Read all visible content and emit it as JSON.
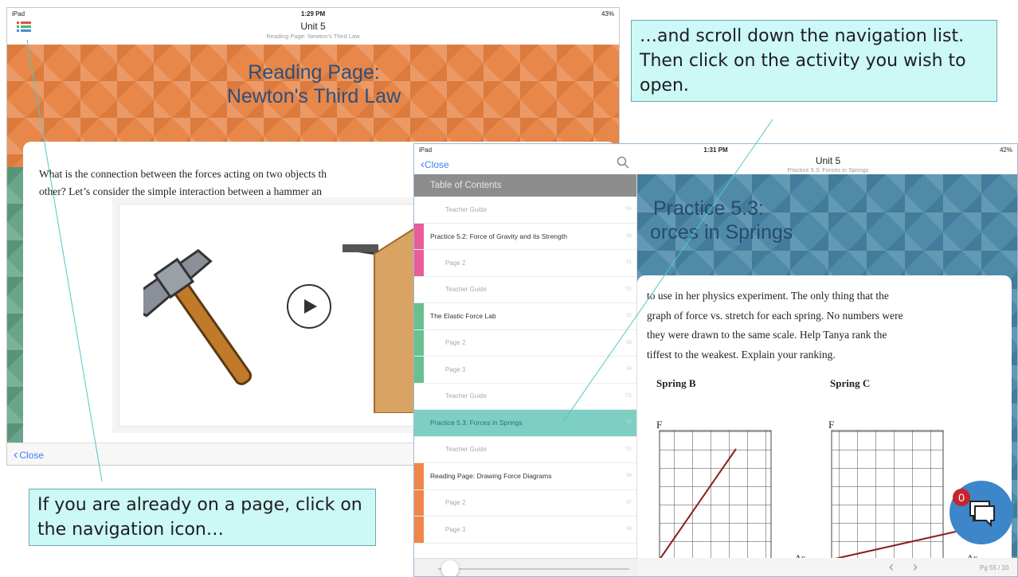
{
  "left_screen": {
    "status": {
      "device": "iPad",
      "time": "1:29 PM",
      "battery": "43%"
    },
    "nav": {
      "title": "Unit 5",
      "subtitle": "Reading Page: Newton's Third Law"
    },
    "hero_title_line1": "Reading Page:",
    "hero_title_line2": "Newton's Third Law",
    "body_line1": "What is the connection between the forces acting on two objects th",
    "body_line2": "other? Let’s consider the simple interaction between a hammer an",
    "close_label": "Close",
    "icons": {
      "nav": "list-icon",
      "play": "play-icon",
      "back": "chevron-left-icon"
    }
  },
  "right_screen": {
    "status": {
      "device": "iPad",
      "time": "1:31 PM",
      "battery": "42%"
    },
    "nav": {
      "close_label": "Close",
      "title": "Unit 5",
      "subtitle": "Practice 5.3: Forces in Springs"
    },
    "toc_header": "Table of Contents",
    "toc_items": [
      {
        "label": "Teacher Guide",
        "page": "TG",
        "sub": true,
        "color": ""
      },
      {
        "label": "Practice 5.2: Force of Gravity and its Strength",
        "page": "50",
        "sub": false,
        "color": "#e85d9a"
      },
      {
        "label": "Page 2",
        "page": "51",
        "sub": true,
        "color": "#e85d9a"
      },
      {
        "label": "Teacher Guide",
        "page": "TG",
        "sub": true,
        "color": ""
      },
      {
        "label": "The Elastic Force Lab",
        "page": "52",
        "sub": false,
        "color": "#67c08e"
      },
      {
        "label": "Page 2",
        "page": "53",
        "sub": true,
        "color": "#67c08e"
      },
      {
        "label": "Page 3",
        "page": "54",
        "sub": true,
        "color": "#67c08e"
      },
      {
        "label": "Teacher Guide",
        "page": "TG",
        "sub": true,
        "color": ""
      },
      {
        "label": "Practice 5.3: Forces in Springs",
        "page": "55",
        "sub": false,
        "color": "#7ecfc3",
        "selected": true
      },
      {
        "label": "Teacher Guide",
        "page": "TG",
        "sub": true,
        "color": ""
      },
      {
        "label": "Reading Page: Drawing Force Diagrams",
        "page": "56",
        "sub": false,
        "color": "#f0874a"
      },
      {
        "label": "Page 2",
        "page": "57",
        "sub": true,
        "color": "#f0874a"
      },
      {
        "label": "Page 3",
        "page": "58",
        "sub": true,
        "color": "#f0874a"
      }
    ],
    "hero_title_line1": "Practice 5.3:",
    "hero_title_line2": "orces in Springs",
    "body_lines": [
      "to use in her physics experiment. The only thing that the",
      "graph of force vs. stretch for each spring. No numbers were",
      "they were drawn to the same scale. Help Tanya rank the",
      "tiffest to the weakest. Explain your ranking."
    ],
    "spring_b_label": "Spring B",
    "spring_c_label": "Spring C",
    "axis_y": "F",
    "axis_x": "Δx",
    "chat_badge": "0",
    "page_indicator": "Pg 55 / 10",
    "icons": {
      "search": "search-icon",
      "chat": "chat-bubble-icon",
      "prev": "chevron-left-icon",
      "next": "chevron-right-icon"
    }
  },
  "captions": {
    "top_right": "…and scroll down the navigation list. Then click on the activity you wish to open.",
    "bottom_left": "If you are already on a page, click on the navigation icon…"
  },
  "colors": {
    "hero_orange": "#ee9443",
    "hero_blue": "#4f8ba9",
    "selected_teal": "#7ecfc3",
    "link_blue": "#3d7ef5",
    "caption_bg": "#ccf8f6"
  }
}
